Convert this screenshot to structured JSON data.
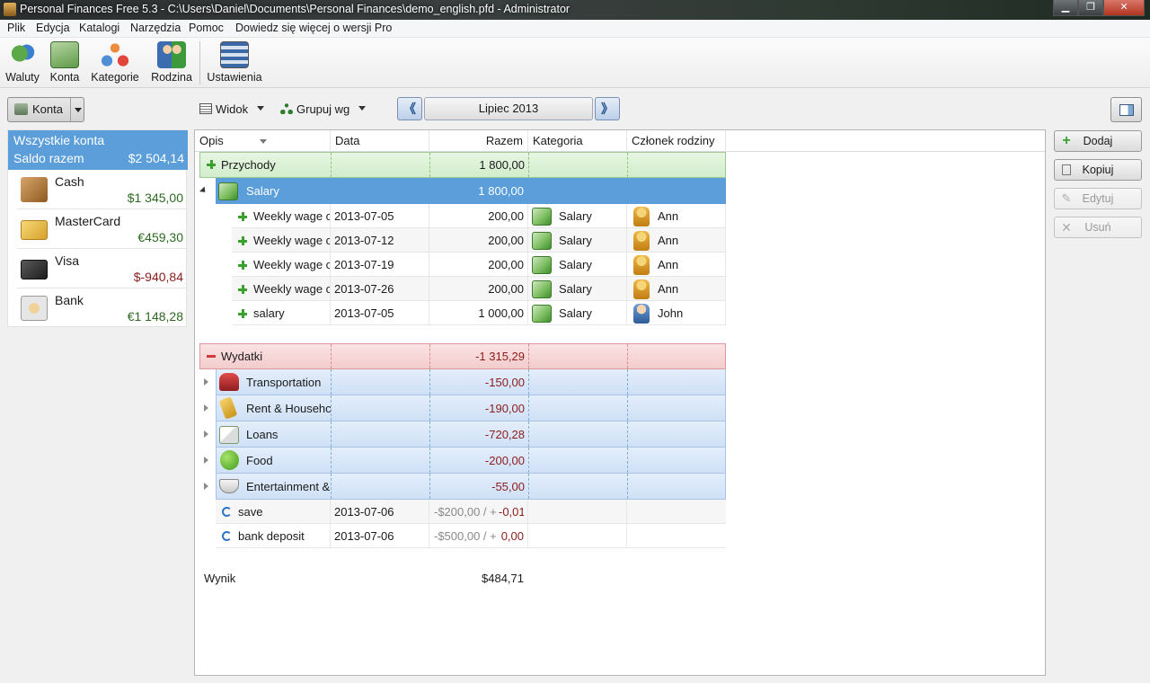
{
  "window": {
    "title": "Personal Finances Free 5.3 - C:\\Users\\Daniel\\Documents\\Personal Finances\\demo_english.pfd - Administrator",
    "minimize": "▁",
    "maximize": "❐",
    "close": "✕"
  },
  "menu": [
    "Plik",
    "Edycja",
    "Katalogi",
    "Narzędzia",
    "Pomoc",
    "Dowiedz się więcej o wersji Pro"
  ],
  "toolbar": [
    {
      "label": "Waluty",
      "icon": "currency-exchange-icon"
    },
    {
      "label": "Konta",
      "icon": "accounts-money-icon"
    },
    {
      "label": "Kategorie",
      "icon": "categories-hierarchy-icon"
    },
    {
      "label": "Rodzina",
      "icon": "family-people-icon"
    },
    {
      "label": "Ustawienia",
      "icon": "settings-sliders-icon"
    }
  ],
  "accounts_button": "Konta",
  "accounts": {
    "all_title": "Wszystkie konta",
    "all_subtitle": "Saldo razem",
    "all_balance": "$2 504,14",
    "items": [
      {
        "name": "Cash",
        "balance": "$1 345,00",
        "icon": "wallet-icon"
      },
      {
        "name": "MasterCard",
        "balance": "€459,30",
        "icon": "credit-card-gold-icon"
      },
      {
        "name": "Visa",
        "balance": "$-940,84",
        "icon": "credit-card-dark-icon"
      },
      {
        "name": "Bank",
        "balance": "€1 148,28",
        "icon": "bank-safe-icon"
      }
    ]
  },
  "view_bar": {
    "view_label": "Widok",
    "group_label": "Grupuj wg",
    "prev": "《",
    "next": "》",
    "period": "Lipiec 2013"
  },
  "actions": {
    "add": "Dodaj",
    "copy": "Kopiuj",
    "edit": "Edytuj",
    "delete": "Usuń"
  },
  "columns": [
    "Opis",
    "Data",
    "Razem",
    "Kategoria",
    "Członek rodziny"
  ],
  "income": {
    "label": "Przychody",
    "total": "1 800,00",
    "category": {
      "name": "Salary",
      "total": "1 800,00"
    },
    "transactions": [
      {
        "desc": "Weekly wage c",
        "date": "2013-07-05",
        "amount": "200,00",
        "category": "Salary",
        "member": "Ann"
      },
      {
        "desc": "Weekly wage c",
        "date": "2013-07-12",
        "amount": "200,00",
        "category": "Salary",
        "member": "Ann"
      },
      {
        "desc": "Weekly wage c",
        "date": "2013-07-19",
        "amount": "200,00",
        "category": "Salary",
        "member": "Ann"
      },
      {
        "desc": "Weekly wage c",
        "date": "2013-07-26",
        "amount": "200,00",
        "category": "Salary",
        "member": "Ann"
      },
      {
        "desc": "salary",
        "date": "2013-07-05",
        "amount": "1 000,00",
        "category": "Salary",
        "member": "John"
      }
    ]
  },
  "expenses": {
    "label": "Wydatki",
    "total": "-1 315,29",
    "categories": [
      {
        "name": "Transportation",
        "total": "-150,00",
        "icon": "car-icon"
      },
      {
        "name": "Rent & Househc",
        "total": "-190,00",
        "icon": "key-icon"
      },
      {
        "name": "Loans",
        "total": "-720,28",
        "icon": "envelope-icon"
      },
      {
        "name": "Food",
        "total": "-200,00",
        "icon": "apple-icon"
      },
      {
        "name": "Entertainment &",
        "total": "-55,00",
        "icon": "coffee-cup-icon"
      }
    ],
    "transfers": [
      {
        "desc": "save",
        "date": "2013-07-06",
        "amount_gray": "-$200,00 / +",
        "amount_red": "-0,01"
      },
      {
        "desc": "bank deposit",
        "date": "2013-07-06",
        "amount_gray": "-$500,00 / +",
        "amount_red": "0,00"
      }
    ]
  },
  "result": {
    "label": "Wynik",
    "value": "$484,71"
  }
}
